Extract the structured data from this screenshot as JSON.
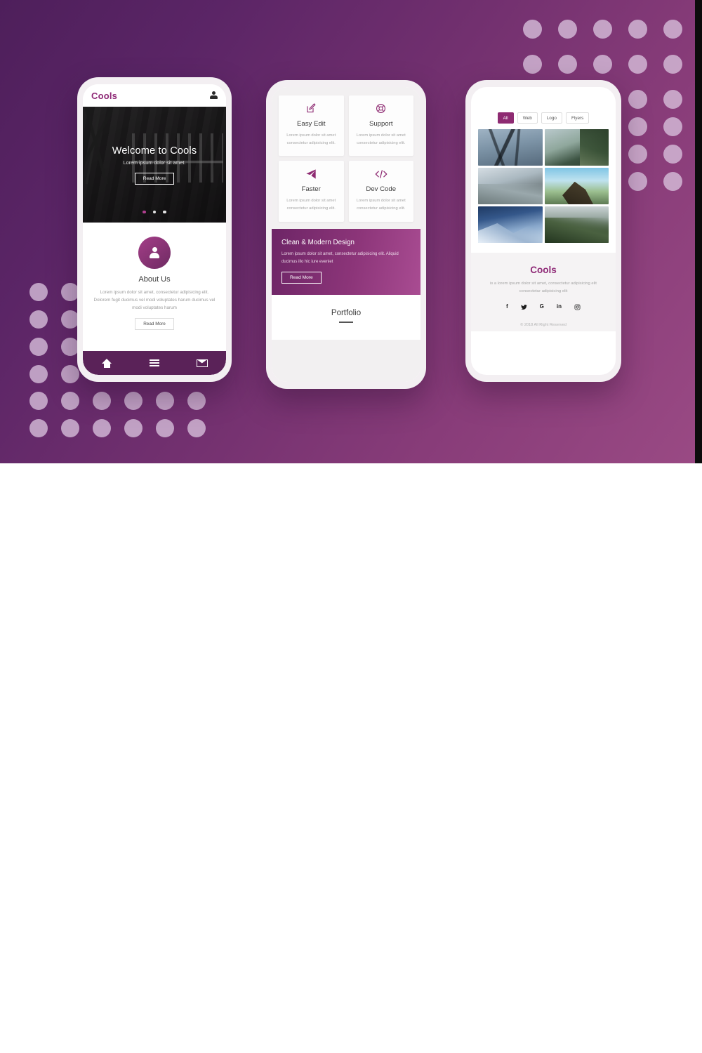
{
  "banner": {
    "background_gradient_from": "#4e1f5b",
    "background_gradient_to": "#9a4a84",
    "accent": "#8e2b72"
  },
  "phone1": {
    "header": {
      "logo": "Cools",
      "account_icon": "user-icon"
    },
    "hero": {
      "title": "Welcome to Cools",
      "subtitle": "Lorem ipsum dolor sit amet.",
      "button": "Read More",
      "slides": 3,
      "active_slide": 1
    },
    "about": {
      "icon": "person-avatar-icon",
      "title": "About Us",
      "text": "Lorem ipsum dolor sit amet, consectetur adipisicing elit. Dolorem fugit ducimus vel modi voluptates harum ducimus vel modi voluptates harum",
      "button": "Read More"
    },
    "nav": [
      {
        "name": "home",
        "icon": "home-icon"
      },
      {
        "name": "menu",
        "icon": "hamburger-menu-icon"
      },
      {
        "name": "mail",
        "icon": "envelope-icon"
      }
    ]
  },
  "phone2": {
    "features": [
      {
        "icon": "pen-edit-icon",
        "title": "Easy Edit",
        "text": "Lorem ipsum dolor sit amet consectetur adipisicing elit."
      },
      {
        "icon": "lifebuoy-icon",
        "title": "Support",
        "text": "Lorem ipsum dolor sit amet consectetur adipisicing elit."
      },
      {
        "icon": "paper-plane-icon",
        "title": "Faster",
        "text": "Lorem ipsum dolor sit amet consectetur adipisicing elit."
      },
      {
        "icon": "code-brackets-icon",
        "title": "Dev Code",
        "text": "Lorem ipsum dolor sit amet consectetur adipisicing elit."
      }
    ],
    "cta": {
      "title": "Clean & Modern Design",
      "text": "Lorem ipsum dolor sit amet, consectetur adipisicing elit. Aliquid ducimus illo hic iure eveniet",
      "button": "Read More"
    },
    "portfolio": {
      "title": "Portfolio"
    }
  },
  "phone3": {
    "filters": [
      {
        "label": "All",
        "active": true
      },
      {
        "label": "Web",
        "active": false
      },
      {
        "label": "Logo",
        "active": false
      },
      {
        "label": "Flyers",
        "active": false
      }
    ],
    "gallery": [
      {
        "alt": "misty-lake-with-branches"
      },
      {
        "alt": "mountain-lake-forest-path"
      },
      {
        "alt": "mountain-road"
      },
      {
        "alt": "person-on-cliff-sunrise"
      },
      {
        "alt": "snowy-mountain-range"
      },
      {
        "alt": "forest-river-valley"
      }
    ],
    "footer": {
      "brand": "Cools",
      "tagline": "is a lorem ipsum dolor sit amet, consectetur adipisicing elit consectetur adipisicing elit",
      "social": [
        {
          "name": "facebook",
          "glyph": "f"
        },
        {
          "name": "twitter",
          "glyph": "ᵛ"
        },
        {
          "name": "google",
          "glyph": "G"
        },
        {
          "name": "linkedin",
          "glyph": "in"
        },
        {
          "name": "instagram",
          "glyph": "▣"
        }
      ],
      "copyright": "© 2018 All Right Reserved"
    }
  }
}
